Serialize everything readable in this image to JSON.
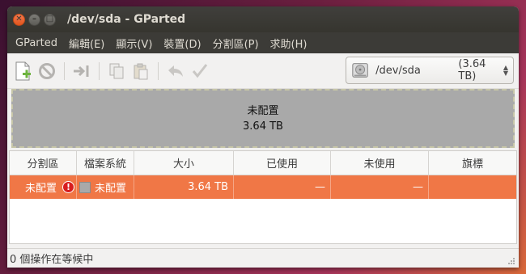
{
  "window": {
    "title": "/dev/sda - GParted"
  },
  "menubar": [
    "GParted",
    "編輯(E)",
    "顯示(V)",
    "裝置(D)",
    "分割區(P)",
    "求助(H)"
  ],
  "device": {
    "name": "/dev/sda",
    "size": "(3.64 TB)"
  },
  "diskmap": {
    "label": "未配置",
    "size": "3.64 TB"
  },
  "table": {
    "headers": [
      "分割區",
      "檔案系統",
      "大小",
      "已使用",
      "未使用",
      "旗標"
    ],
    "row": {
      "partition": "未配置",
      "filesystem": "未配置",
      "size": "3.64 TB",
      "used": "—",
      "unused": "—",
      "flags": ""
    }
  },
  "status": "0 個操作在等候中",
  "colors": {
    "selected_row": "#f07746",
    "unallocated": "#a9a9a9",
    "close_button": "#e2541c"
  }
}
